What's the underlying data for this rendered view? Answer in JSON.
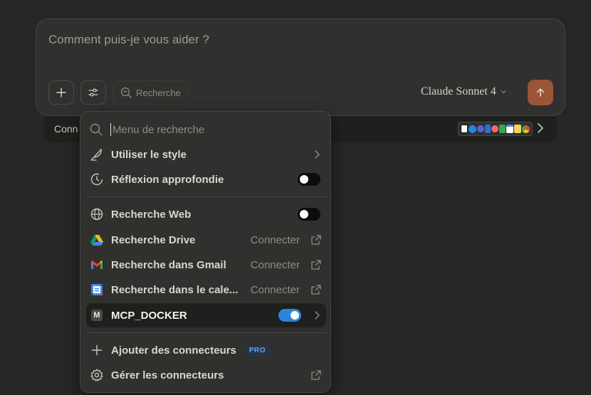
{
  "composer": {
    "placeholder": "Comment puis-je vous aider ?",
    "search_chip_label": "Recherche",
    "model_label": "Claude Sonnet 4"
  },
  "connectors_strip": {
    "label": "Conn"
  },
  "menu": {
    "search_placeholder": "Menu de recherche",
    "items": [
      {
        "label": "Utiliser le style",
        "icon": "feather-icon"
      },
      {
        "label": "Réflexion approfondie",
        "icon": "clock-icon",
        "toggle": false
      },
      {
        "label": "Recherche Web",
        "icon": "globe-icon",
        "toggle": false
      },
      {
        "label": "Recherche Drive",
        "icon": "google-drive-icon",
        "action": "Connecter"
      },
      {
        "label": "Recherche dans Gmail",
        "icon": "gmail-icon",
        "action": "Connecter"
      },
      {
        "label": "Recherche dans le cale...",
        "icon": "google-calendar-icon",
        "action": "Connecter"
      },
      {
        "label": "MCP_DOCKER",
        "icon": "m-badge-icon",
        "toggle": true,
        "badge_letter": "M"
      },
      {
        "label": "Ajouter des connecteurs",
        "icon": "plus-icon",
        "badge": "PRO"
      },
      {
        "label": "Gérer les connecteurs",
        "icon": "gear-icon"
      }
    ]
  },
  "colors": {
    "background": "#262624",
    "panel": "#30302e",
    "send_button": "#9a5438",
    "toggle_on": "#2c84db",
    "pro_badge": "#6aa4e8"
  }
}
